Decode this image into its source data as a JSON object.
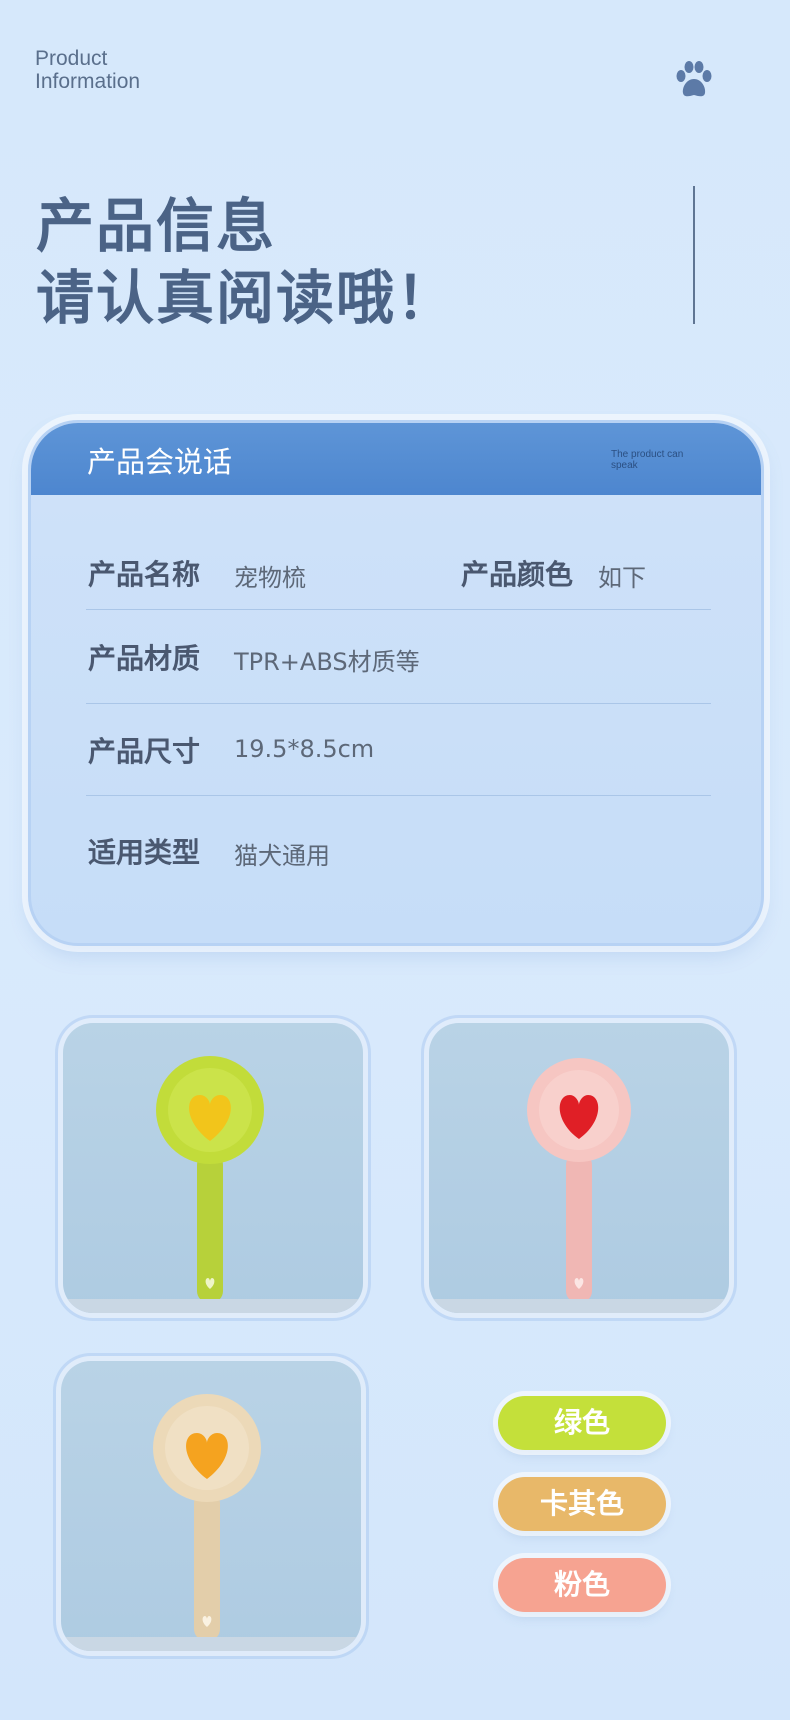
{
  "header": {
    "en_line1": "Product",
    "en_line2": "Information",
    "title_line1": "产品信息",
    "title_line2": "请认真阅读哦！"
  },
  "info_card": {
    "heading": "产品会说话",
    "heading_en": "The product can speak",
    "rows": [
      {
        "label": "产品名称",
        "value": "宠物梳"
      },
      {
        "label": "产品颜色",
        "value": "如下"
      },
      {
        "label": "产品材质",
        "value": "TPR+ABS材质等"
      },
      {
        "label": "产品尺寸",
        "value": "19.5*8.5cm"
      },
      {
        "label": "适用类型",
        "value": "猫犬通用"
      }
    ]
  },
  "variants": [
    {
      "name": "绿色",
      "pill_color": "#c4e03a",
      "brush_color": "#c2dc3a",
      "heart_color": "#f2c51b"
    },
    {
      "name": "卡其色",
      "pill_color": "#e8b869",
      "brush_color": "#ecd9b8",
      "heart_color": "#f5a31f"
    },
    {
      "name": "粉色",
      "pill_color": "#f6a391",
      "brush_color": "#f6c6c2",
      "heart_color": "#e01f26"
    }
  ]
}
